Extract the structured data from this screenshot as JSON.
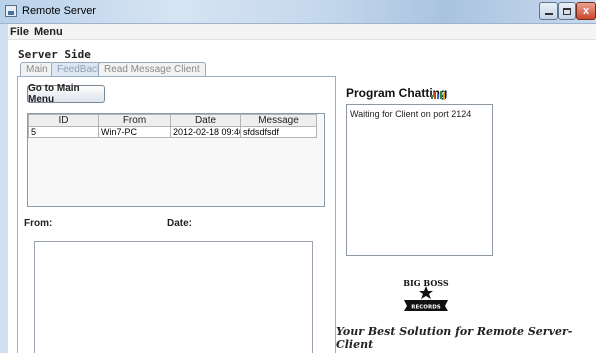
{
  "window": {
    "title": "Remote Server",
    "close_glyph": "x"
  },
  "menu": {
    "items": [
      "File",
      "Menu"
    ]
  },
  "server_side_label": "Server Side",
  "tabs": [
    {
      "label": "Main",
      "selected": false
    },
    {
      "label": "FeedBack",
      "selected": true
    },
    {
      "label": "Read Message Client",
      "selected": false
    }
  ],
  "feedback": {
    "go_to_main_menu": "Go to Main Menu",
    "table": {
      "columns": [
        "ID",
        "From",
        "Date",
        "Message"
      ],
      "rows": [
        {
          "id": "5",
          "from": "Win7-PC",
          "date": "2012-02-18 09:40:4...",
          "message": "sfdsdfsdf"
        }
      ]
    },
    "from_label": "From:",
    "date_label": "Date:"
  },
  "chat": {
    "title": "Program Chatting",
    "icon": "chat-signal-icon",
    "log_text": "Waiting for Client on port 2124"
  },
  "logo": {
    "line1": "BIG BOSS",
    "line2": "RECORDS"
  },
  "tagline": "Your Best Solution for Remote Server-Client",
  "colors": {
    "tab_border": "#97b0cc",
    "titlebar": "#b9d1ea",
    "close": "#c9472d"
  }
}
